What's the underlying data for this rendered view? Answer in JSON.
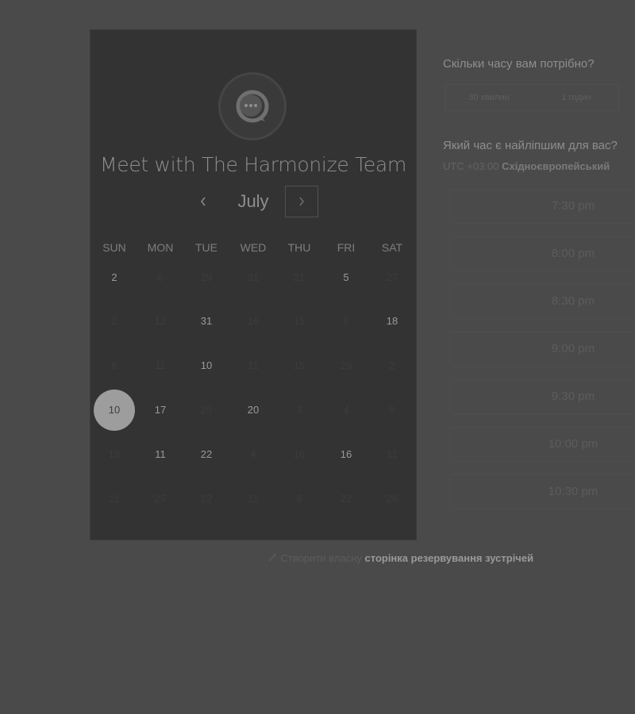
{
  "calendar": {
    "title": "Meet with The Harmonize Team",
    "month": "July",
    "prev_icon": "chevron-left-icon",
    "next_icon": "chevron-right-icon",
    "weekdays": [
      "SUN",
      "MON",
      "TUE",
      "WED",
      "THU",
      "FRI",
      "SAT"
    ],
    "rows": [
      [
        {
          "label": "2",
          "available": true
        },
        {
          "label": "6",
          "available": false
        },
        {
          "label": "29",
          "available": false
        },
        {
          "label": "31",
          "available": false
        },
        {
          "label": "21",
          "available": false
        },
        {
          "label": "5",
          "available": true
        },
        {
          "label": "27",
          "available": false
        }
      ],
      [
        {
          "label": "2",
          "available": false
        },
        {
          "label": "12",
          "available": false
        },
        {
          "label": "31",
          "available": true
        },
        {
          "label": "16",
          "available": false
        },
        {
          "label": "15",
          "available": false
        },
        {
          "label": "6",
          "available": false
        },
        {
          "label": "18",
          "available": true
        }
      ],
      [
        {
          "label": "6",
          "available": false
        },
        {
          "label": "11",
          "available": false
        },
        {
          "label": "10",
          "available": true
        },
        {
          "label": "11",
          "available": false
        },
        {
          "label": "15",
          "available": false
        },
        {
          "label": "29",
          "available": false
        },
        {
          "label": "2",
          "available": false
        }
      ],
      [
        {
          "label": "10",
          "available": true,
          "selected": true
        },
        {
          "label": "17",
          "available": true
        },
        {
          "label": "25",
          "available": false
        },
        {
          "label": "20",
          "available": true
        },
        {
          "label": "3",
          "available": false
        },
        {
          "label": "4",
          "available": false
        },
        {
          "label": "5",
          "available": false
        }
      ],
      [
        {
          "label": "18",
          "available": false
        },
        {
          "label": "11",
          "available": true
        },
        {
          "label": "22",
          "available": true
        },
        {
          "label": "4",
          "available": false
        },
        {
          "label": "16",
          "available": false
        },
        {
          "label": "16",
          "available": true
        },
        {
          "label": "11",
          "available": false
        }
      ],
      [
        {
          "label": "11",
          "available": false
        },
        {
          "label": "25",
          "available": false
        },
        {
          "label": "22",
          "available": false
        },
        {
          "label": "11",
          "available": false
        },
        {
          "label": "8",
          "available": false
        },
        {
          "label": "22",
          "available": false
        },
        {
          "label": "26",
          "available": false
        }
      ]
    ]
  },
  "duration": {
    "question": "Скільки часу вам потрібно?",
    "options": [
      "30 хвилин",
      "1 годин"
    ]
  },
  "time": {
    "question": "Який час є найліпшим для вас?",
    "tz_offset": "UTC +03:00",
    "tz_name": "Східноєвропейський",
    "slots": [
      "7:30 pm",
      "8:00 pm",
      "8:30 pm",
      "9:00 pm",
      "9:30 pm",
      "10:00 pm",
      "10:30 pm"
    ]
  },
  "footer": {
    "icon": "sparkle-icon",
    "text": "Створити власну",
    "link": "сторінка резервування зустрічей"
  },
  "colors": {
    "background": "#4a4a4a",
    "card": "#333333",
    "selected_day": "#9d9d9d"
  }
}
